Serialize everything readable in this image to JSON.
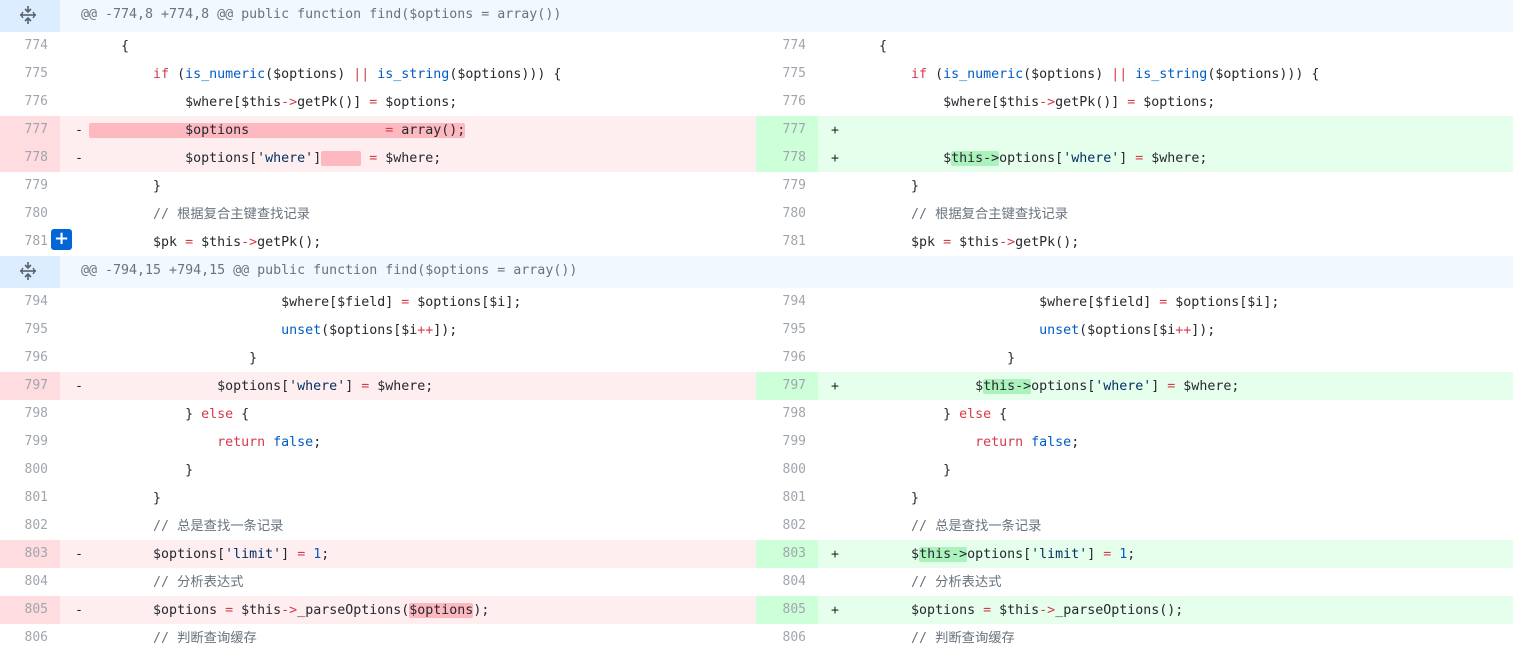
{
  "hunk1": {
    "header": "@@ -774,8 +774,8 @@ public function find($options = array())",
    "expand_icon": "unfold-icon"
  },
  "hunk2": {
    "header": "@@ -794,15 +794,15 @@ public function find($options = array())",
    "expand_icon": "unfold-icon"
  },
  "add_comment_button": "+",
  "markers": {
    "del": "-",
    "add": "+"
  },
  "lines": {
    "l774": {
      "ln": "774",
      "rn": "774"
    },
    "l775": {
      "ln": "775",
      "rn": "775"
    },
    "l776": {
      "ln": "776",
      "rn": "776"
    },
    "l777": {
      "ln": "777",
      "rn": "777"
    },
    "l778": {
      "ln": "778",
      "rn": "778"
    },
    "l779": {
      "ln": "779",
      "rn": "779"
    },
    "l780": {
      "ln": "780",
      "rn": "780"
    },
    "l781": {
      "ln": "781",
      "rn": "781"
    },
    "l794": {
      "ln": "794",
      "rn": "794"
    },
    "l795": {
      "ln": "795",
      "rn": "795"
    },
    "l796": {
      "ln": "796",
      "rn": "796"
    },
    "l797": {
      "ln": "797",
      "rn": "797"
    },
    "l798": {
      "ln": "798",
      "rn": "798"
    },
    "l799": {
      "ln": "799",
      "rn": "799"
    },
    "l800": {
      "ln": "800",
      "rn": "800"
    },
    "l801": {
      "ln": "801",
      "rn": "801"
    },
    "l802": {
      "ln": "802",
      "rn": "802"
    },
    "l803": {
      "ln": "803",
      "rn": "803"
    },
    "l804": {
      "ln": "804",
      "rn": "804"
    },
    "l805": {
      "ln": "805",
      "rn": "805"
    },
    "l806": {
      "ln": "806",
      "rn": "806"
    }
  },
  "tokens": {
    "t_brace": "{",
    "t_if": "if",
    "t_open": " (",
    "t_isnum": "is_numeric",
    "t_opts_paren": "($options)",
    "t_or": "||",
    "t_isstr": "is_string",
    "t_close_brace": ")) {",
    "t_where_pk": "$where[$this",
    "t_arrow": "->",
    "t_getpk": "getPk()] ",
    "t_eq": "=",
    "t_opts_semi": " $options;",
    "t_options": "$options",
    "t_pad777": "                 ",
    "t_array": " array();",
    "t_options_open": "$options[",
    "t_where_str": "'where'",
    "t_close_bracket": "]",
    "t_pad778": "     ",
    "t_where_semi": " $where;",
    "t_close": "}",
    "t_cm_pk": "// 根据复合主键查找记录",
    "t_pk": "$pk ",
    "t_this": " $this",
    "t_getpk2": "getPk();",
    "t_this_arrow": "this->",
    "t_dollar": "$",
    "t_options_where": "options[",
    "t_where_field": "$where[$field] ",
    "t_options_i": " $options[$i];",
    "t_unset": "unset",
    "t_unset_args": "($options[$i",
    "t_pp": "++",
    "t_unset_close": "]);",
    "t_else_open": "} ",
    "t_else": "else",
    "t_brace_sp": " {",
    "t_return": "return",
    "t_false": "false",
    "t_semi": ";",
    "t_cm_one": "// 总是查找一条记录",
    "t_limit_str": "'limit'",
    "t_one": "1",
    "t_cm_parse": "// 分析表达式",
    "t_opts_sp": "$options ",
    "t_parse": "_parseOptions(",
    "t_parse_close": ");",
    "t_parse_empty": "_parseOptions();",
    "t_cm_cache": "// 判断查询缓存"
  }
}
